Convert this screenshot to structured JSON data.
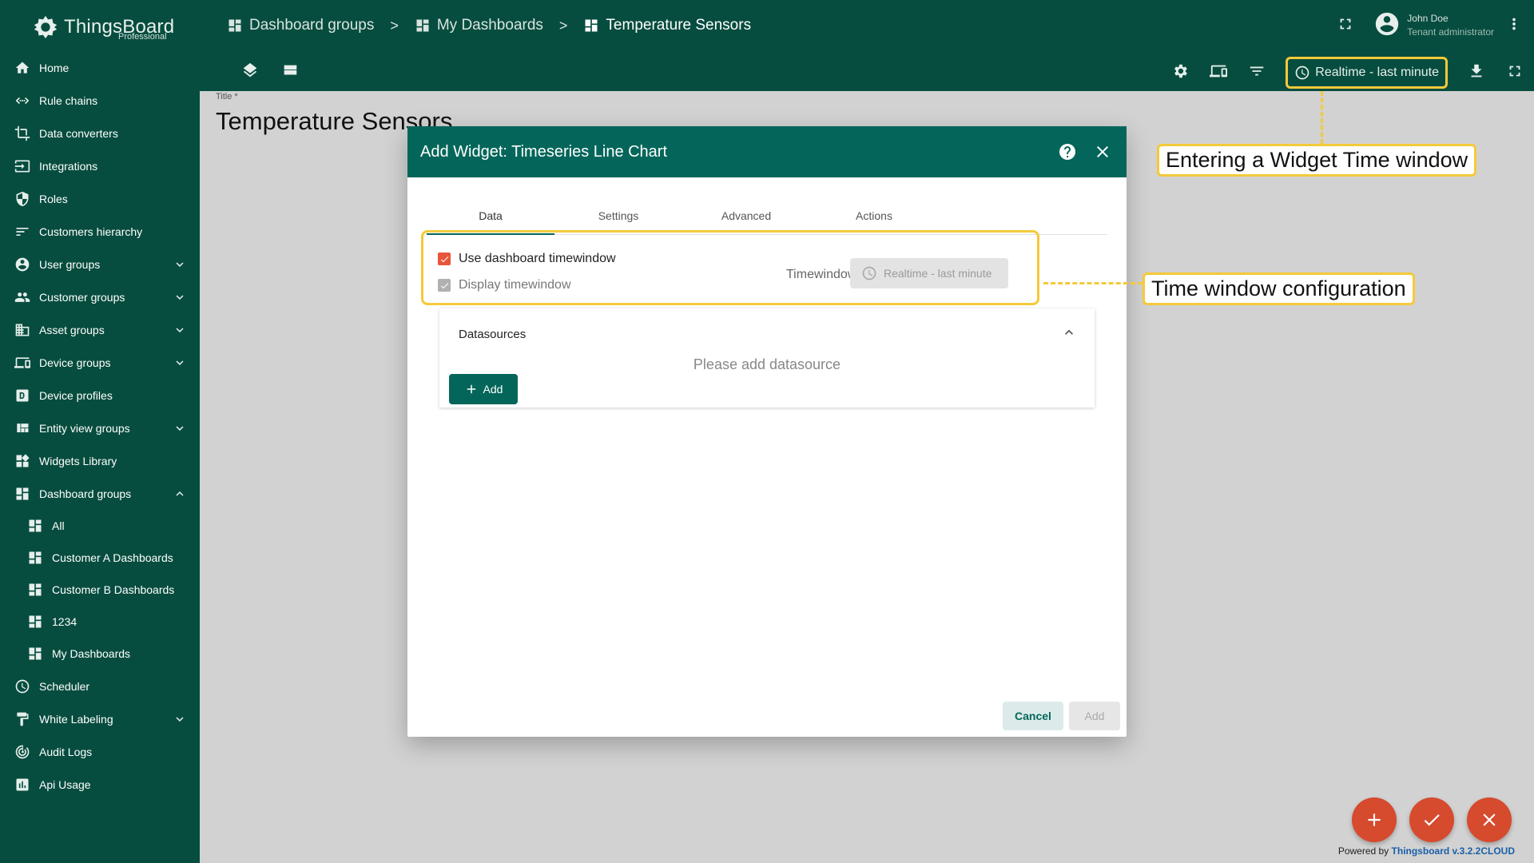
{
  "app": {
    "logo_text": "ThingsBoard",
    "logo_sub": "Professional"
  },
  "sidebar": {
    "items": [
      {
        "label": "Home",
        "icon": "home-icon"
      },
      {
        "label": "Rule chains",
        "icon": "rule-chains-icon"
      },
      {
        "label": "Data converters",
        "icon": "data-converters-icon"
      },
      {
        "label": "Integrations",
        "icon": "integrations-icon"
      },
      {
        "label": "Roles",
        "icon": "shield-icon"
      },
      {
        "label": "Customers hierarchy",
        "icon": "sort-icon"
      },
      {
        "label": "User groups",
        "icon": "account-circle-icon"
      },
      {
        "label": "Customer groups",
        "icon": "people-icon"
      },
      {
        "label": "Asset groups",
        "icon": "domain-icon"
      },
      {
        "label": "Device groups",
        "icon": "devices-icon"
      },
      {
        "label": "Device profiles",
        "icon": "device-profile-icon"
      },
      {
        "label": "Entity view groups",
        "icon": "view-quilt-icon"
      },
      {
        "label": "Widgets Library",
        "icon": "widgets-icon"
      },
      {
        "label": "Dashboard groups",
        "icon": "dashboard-icon"
      }
    ],
    "sub_items": [
      "All",
      "Customer A Dashboards",
      "Customer B Dashboards",
      "1234",
      "My Dashboards"
    ],
    "items_after": [
      {
        "label": "Scheduler",
        "icon": "schedule-icon"
      },
      {
        "label": "White Labeling",
        "icon": "format-paint-icon"
      },
      {
        "label": "Audit Logs",
        "icon": "track-changes-icon"
      },
      {
        "label": "Api Usage",
        "icon": "insert-chart-icon"
      }
    ]
  },
  "breadcrumb": [
    "Dashboard groups",
    "My Dashboards",
    "Temperature Sensors"
  ],
  "breadcrumb_sep": ">",
  "user": {
    "name": "John Doe",
    "role": "Tenant administrator"
  },
  "toolbar": {
    "timewindow": "Realtime - last minute"
  },
  "content": {
    "title_label": "Title *",
    "title_value": "Temperature Sensors"
  },
  "dialog": {
    "title": "Add Widget: Timeseries Line Chart",
    "tabs": [
      "Data",
      "Settings",
      "Advanced",
      "Actions"
    ],
    "use_dashboard_tw": "Use dashboard timewindow",
    "display_tw": "Display timewindow",
    "timewindow_label": "Timewindow",
    "timewindow_value": "Realtime - last minute",
    "datasources_title": "Datasources",
    "datasources_empty": "Please add datasource",
    "add_datasource": "Add",
    "cancel": "Cancel",
    "add": "Add"
  },
  "callouts": {
    "widget_tw": "Entering a Widget Time window",
    "tw_config": "Time window configuration"
  },
  "footer": {
    "powered_prefix": "Powered by",
    "powered_link": "Thingsboard v.3.2.2CLOUD"
  },
  "colors": {
    "primary": "#074d3f",
    "dialog_header": "#04665a",
    "accent": "#d64a2e",
    "highlight": "#f5c93a"
  }
}
